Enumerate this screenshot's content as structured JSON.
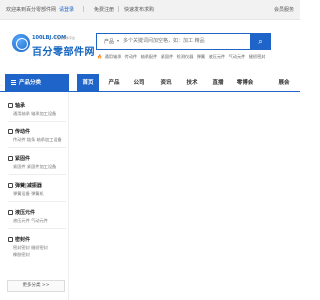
{
  "topbar": {
    "welcome": "欢迎来到百分零部件网",
    "login": "请登录",
    "register": "免费注册",
    "publish": "快速发布求购",
    "member_center": "会员服务"
  },
  "header": {
    "logo_url": "100LBJ.COM",
    "logo_tag": "专业零部件平台",
    "logo_name": "百分零部件网",
    "search_category": "产品",
    "search_placeholder": "多个关键词间加空格，如：加工 精品",
    "search_icon": "search-icon",
    "hot_words": [
      "通用轴承",
      "传动件",
      "轴承配件",
      "紧固件",
      "检测仪器",
      "弹簧",
      "液压元件",
      "气动元件",
      "缝纫密封"
    ]
  },
  "nav": {
    "category_label": "产品分类",
    "items": [
      "首页",
      "产品",
      "公司",
      "资讯",
      "技术",
      "直播",
      "零博会",
      "",
      "展会"
    ],
    "active_index": 0
  },
  "sidebar": {
    "categories": [
      {
        "title": "轴承",
        "subs": [
          "通用轴承  轴承加工设备"
        ]
      },
      {
        "title": "传动件",
        "subs": [
          "传动件  链条  轴承加工设备"
        ]
      },
      {
        "title": "紧固件",
        "subs": [
          "紧固件  紧固件加工设备"
        ]
      },
      {
        "title": "弹簧|减振器",
        "subs": [
          "弹簧设备  弹簧机"
        ]
      },
      {
        "title": "液压元件",
        "subs": [
          "液压元件  气动元件"
        ]
      },
      {
        "title": "密封件",
        "subs": [
          "密封密封  缝纫密封",
          "橡胶密封"
        ]
      }
    ],
    "more_label": "更多分类 >>"
  },
  "colors": {
    "accent": "#1f64c8",
    "hot_icon": "#e8521f"
  }
}
